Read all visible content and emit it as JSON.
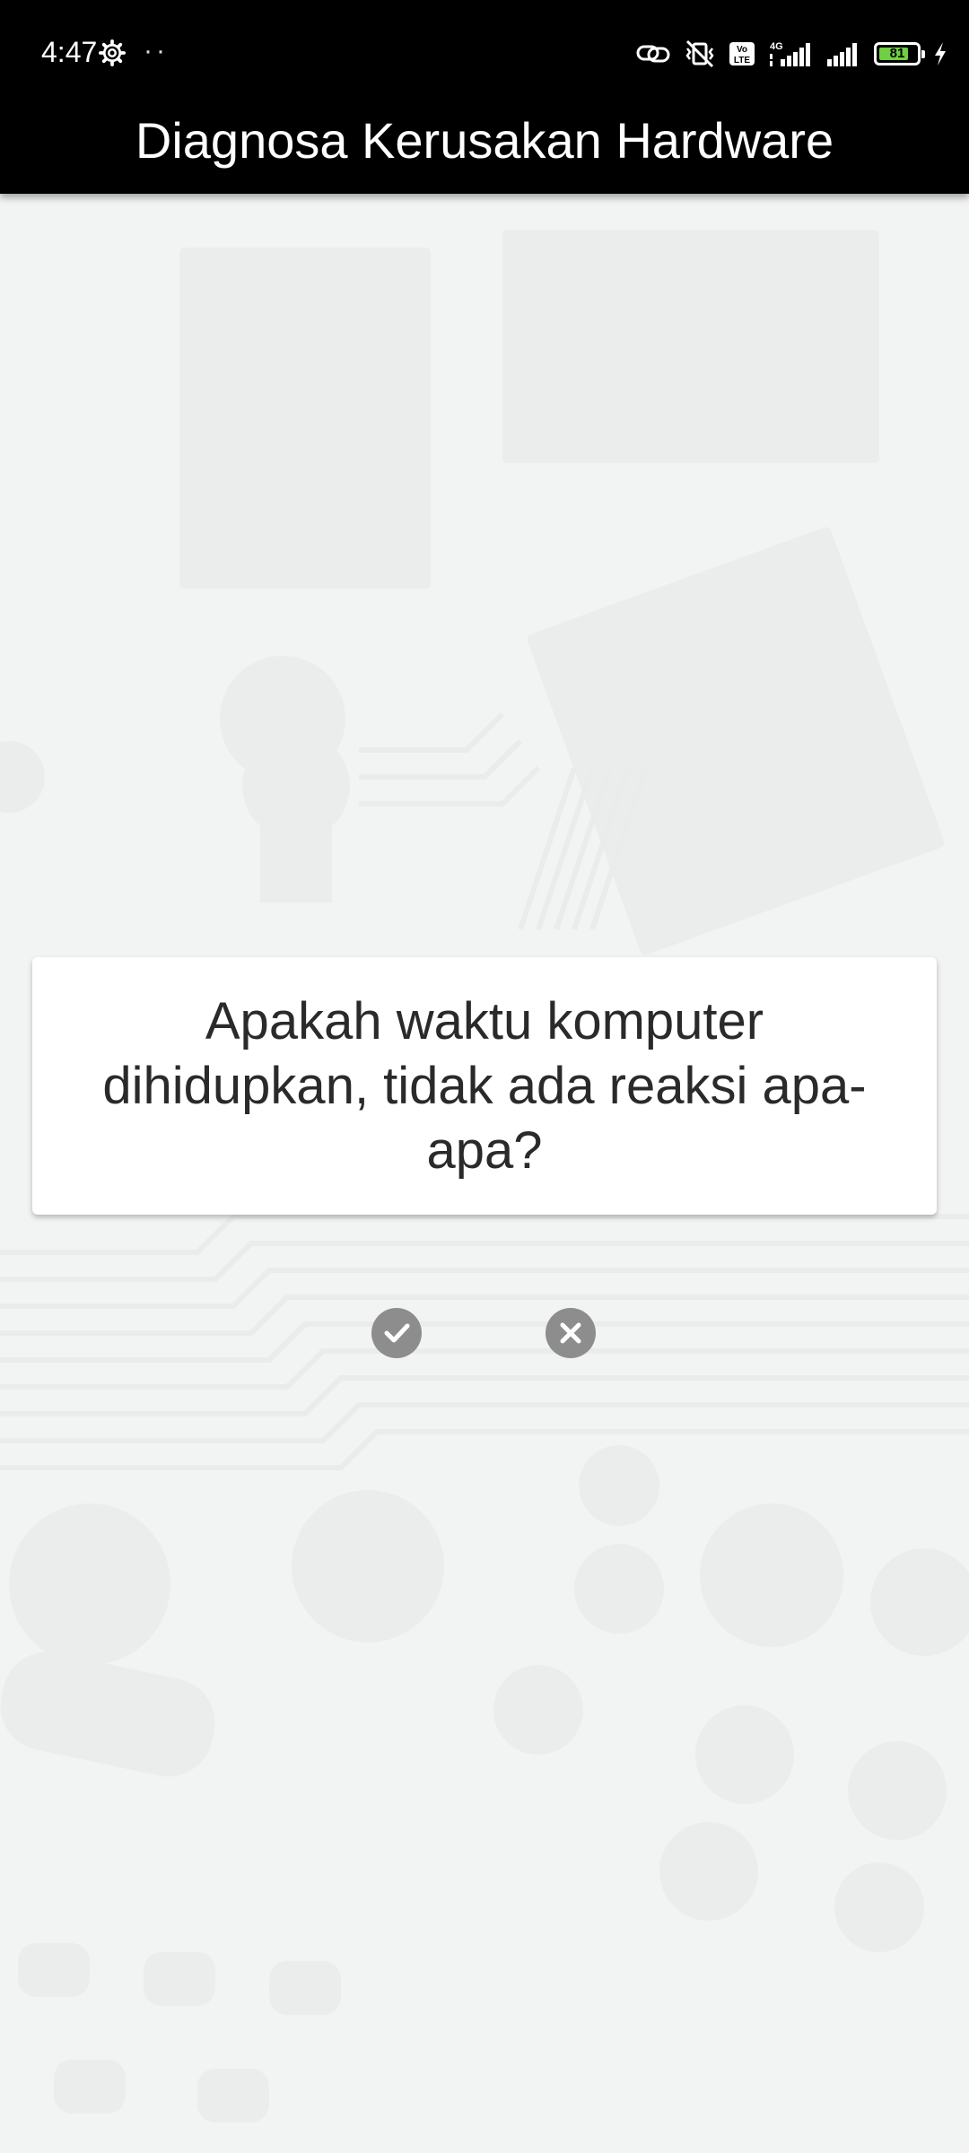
{
  "status_bar": {
    "time": "4:47",
    "dots": "··",
    "battery_level": "81",
    "battery_percent": 81,
    "network_label": "4G",
    "volte_label": "Vo LTE"
  },
  "app_bar": {
    "title": "Diagnosa Kerusakan Hardware"
  },
  "question": {
    "text": "Apakah waktu komputer dihidupkan, tidak ada reaksi apa-apa?"
  },
  "answers": {
    "yes_icon": "check-circle-icon",
    "no_icon": "close-circle-icon"
  },
  "colors": {
    "app_bar_bg": "#000000",
    "background": "#f2f3f3",
    "button_gray": "#8d8d8d",
    "battery_green": "#6fd043"
  }
}
